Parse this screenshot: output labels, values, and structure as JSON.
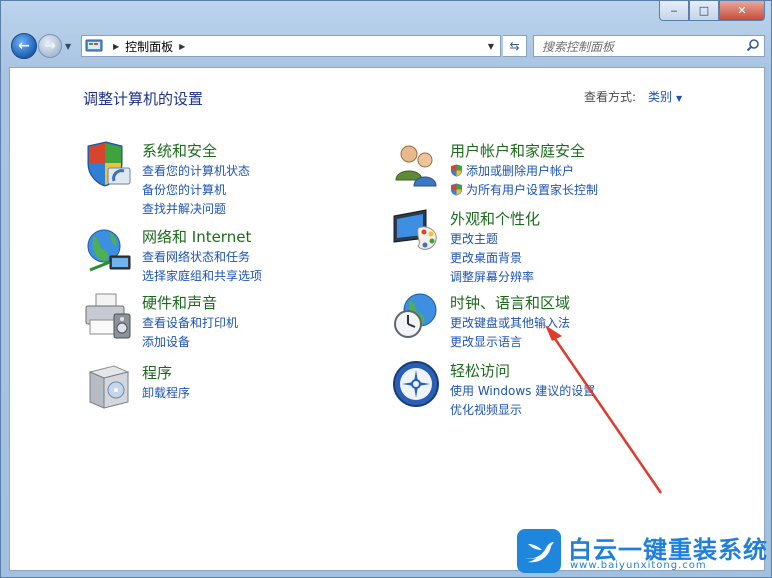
{
  "window": {
    "min_glyph": "‒",
    "max_glyph": "□",
    "close_glyph": "✕"
  },
  "nav": {
    "back_glyph": "←",
    "forward_glyph": "→",
    "breadcrumb": "控制面板",
    "search_placeholder": "搜索控制面板"
  },
  "main": {
    "title": "调整计算机的设置",
    "view_by_label": "查看方式:",
    "view_by_value": "类别"
  },
  "categories": [
    {
      "title": "系统和安全",
      "icon": "shield-pc-icon",
      "links": [
        "查看您的计算机状态",
        "备份您的计算机",
        "查找并解决问题"
      ]
    },
    {
      "title": "网络和 Internet",
      "icon": "globe-network-icon",
      "links": [
        "查看网络状态和任务",
        "选择家庭组和共享选项"
      ]
    },
    {
      "title": "硬件和声音",
      "icon": "printer-speaker-icon",
      "links": [
        "查看设备和打印机",
        "添加设备"
      ]
    },
    {
      "title": "程序",
      "icon": "programs-box-icon",
      "links": [
        "卸载程序"
      ]
    },
    {
      "title": "用户帐户和家庭安全",
      "icon": "users-icon",
      "links": [
        "添加或删除用户帐户",
        "为所有用户设置家长控制"
      ]
    },
    {
      "title": "外观和个性化",
      "icon": "monitor-palette-icon",
      "links": [
        "更改主题",
        "更改桌面背景",
        "调整屏幕分辨率"
      ]
    },
    {
      "title": "时钟、语言和区域",
      "icon": "clock-globe-icon",
      "links": [
        "更改键盘或其他输入法",
        "更改显示语言"
      ]
    },
    {
      "title": "轻松访问",
      "icon": "ease-of-access-icon",
      "links": [
        "使用 Windows 建议的设置",
        "优化视频显示"
      ]
    }
  ],
  "watermark": {
    "text": "白云一键重装系统",
    "url": "www.baiyunxitong.com"
  },
  "colors": {
    "category_title": "#1c6b1c",
    "link": "#1e54b0",
    "page_title": "#1e3287",
    "annotation_arrow": "#e03a2c"
  }
}
